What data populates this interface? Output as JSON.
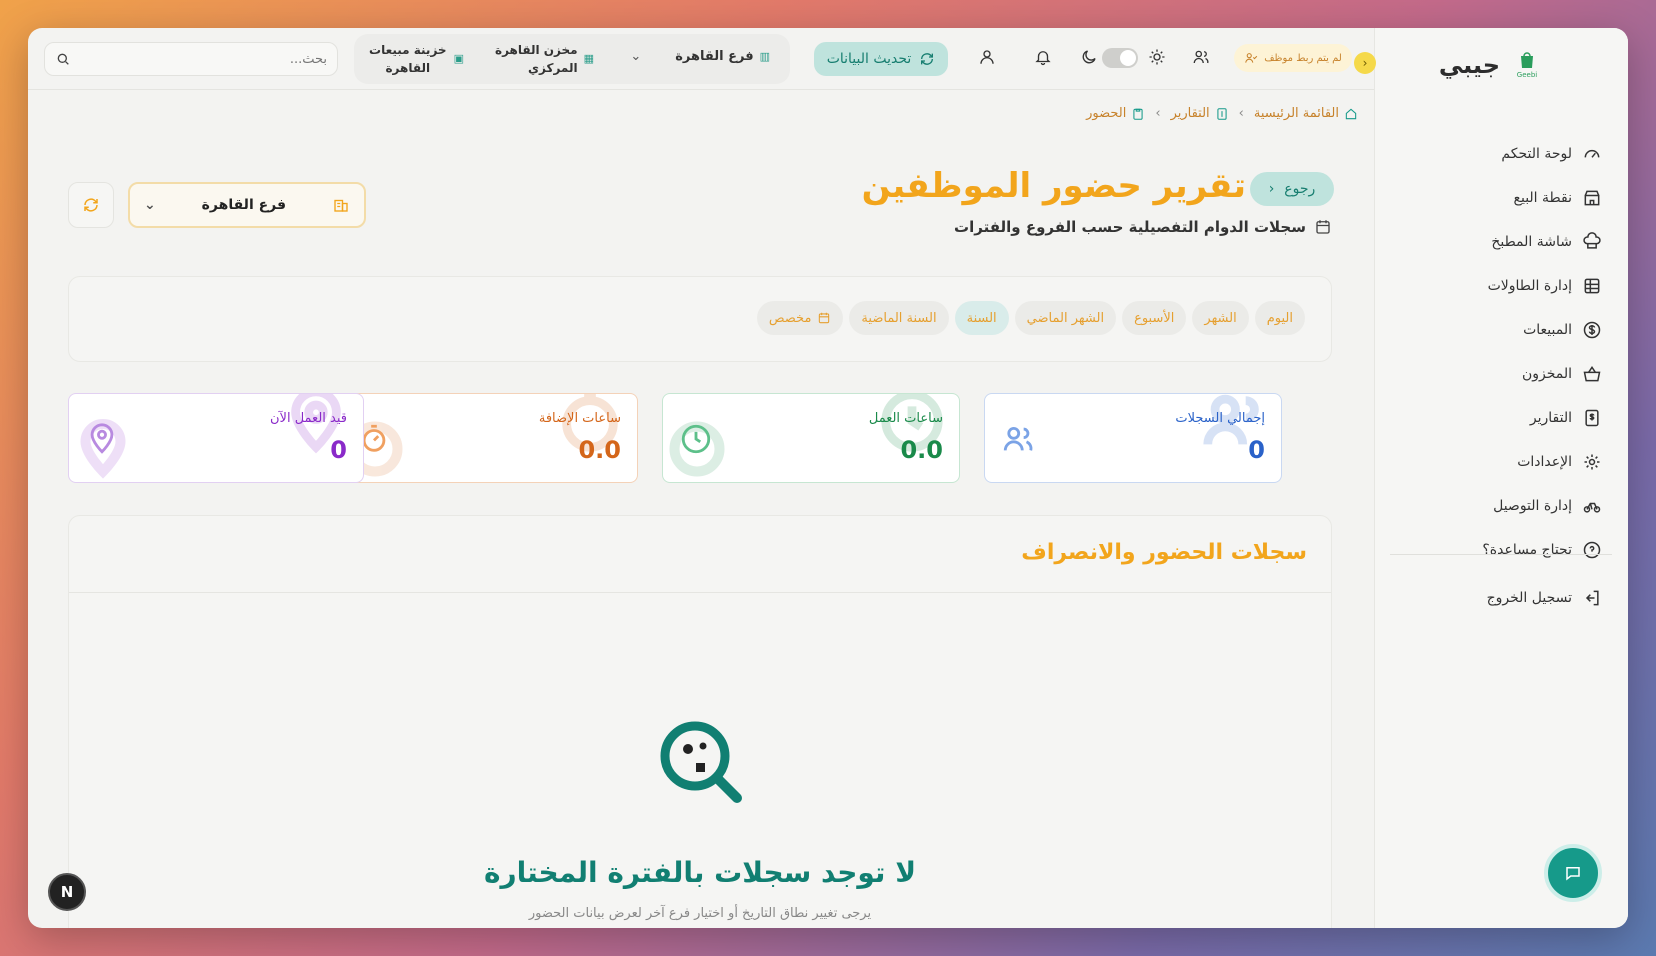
{
  "brand": {
    "name": "جيبي",
    "logo_text": "Geebi"
  },
  "sidebar": {
    "items": [
      {
        "label": "لوحة التحكم",
        "icon": "gauge-icon"
      },
      {
        "label": "نقطة البيع",
        "icon": "store-icon"
      },
      {
        "label": "شاشة المطبخ",
        "icon": "chef-hat-icon"
      },
      {
        "label": "إدارة الطاولات",
        "icon": "table-icon"
      },
      {
        "label": "المبيعات",
        "icon": "dollar-circle-icon"
      },
      {
        "label": "المخزون",
        "icon": "basket-icon"
      },
      {
        "label": "التقارير",
        "icon": "report-icon"
      },
      {
        "label": "الإعدادات",
        "icon": "gear-icon"
      },
      {
        "label": "إدارة التوصيل",
        "icon": "bike-icon"
      },
      {
        "label": "تحتاج مساعدة؟",
        "icon": "help-circle-icon"
      }
    ],
    "logout": "تسجيل الخروج"
  },
  "topbar": {
    "search_placeholder": "بحث...",
    "treasury": "خزينة مبيعات القاهرة",
    "warehouse": "مخزن القاهرة المركزي",
    "branch": "فرع القاهرة",
    "refresh_label": "تحديث البيانات",
    "employee_warning": "لم يتم ربط موظف"
  },
  "breadcrumb": {
    "home": "القائمة الرئيسية",
    "reports": "التقارير",
    "current": "الحضور"
  },
  "header": {
    "back_label": "رجوع",
    "title": "تقرير حضور الموظفين",
    "subtitle": "سجلات الدوام التفصيلية حسب الفروع والفترات",
    "branch_select": "فرع القاهرة"
  },
  "filters": {
    "chips": [
      "اليوم",
      "الشهر",
      "الأسبوع",
      "الشهر الماضي",
      "السنة",
      "السنة الماضية",
      "مخصص"
    ],
    "active": "السنة"
  },
  "stats": [
    {
      "label": "إجمالي السجلات",
      "value": "0",
      "color": "#2a62c9"
    },
    {
      "label": "ساعات العمل",
      "value": "0.0",
      "color": "#1a8a4a"
    },
    {
      "label": "ساعات الإضافة",
      "value": "0.0",
      "color": "#d4661a"
    },
    {
      "label": "قيد العمل الآن",
      "value": "0",
      "color": "#8a2ac9"
    }
  ],
  "records": {
    "title": "سجلات الحضور والانصراف",
    "empty_title": "لا توجد سجلات بالفترة المختارة",
    "empty_sub": "يرجى تغيير نطاق التاريخ أو اختيار فرع آخر لعرض بيانات الحضور"
  },
  "nx_badge": "N",
  "colors": {
    "accent": "#f2a51c",
    "primary": "#169a8a"
  }
}
